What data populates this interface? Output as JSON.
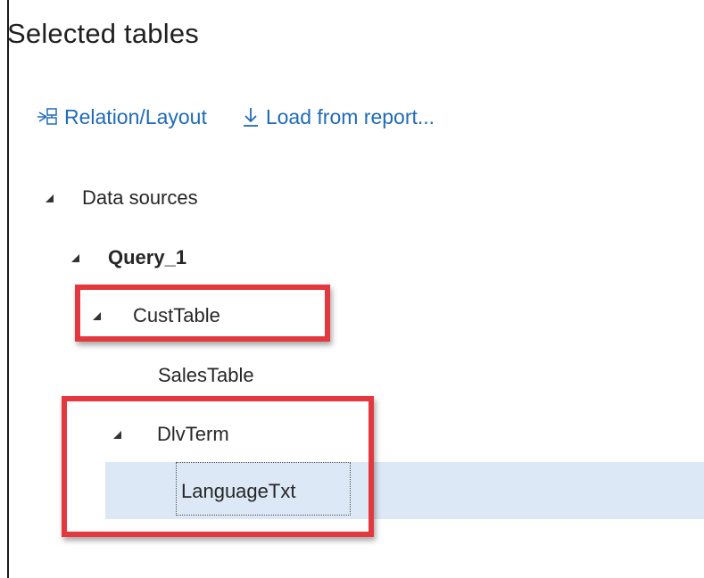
{
  "panel": {
    "title": "Selected tables"
  },
  "toolbar": {
    "relation_layout_label": "Relation/Layout",
    "load_from_report_label": "Load from report..."
  },
  "tree": {
    "data_sources_label": "Data sources",
    "query_label": "Query_1",
    "cust_table_label": "CustTable",
    "sales_table_label": "SalesTable",
    "dlv_term_label": "DlvTerm",
    "language_txt_label": "LanguageTxt"
  },
  "icons": {
    "expander": "expanded-triangle-icon",
    "relation_layout": "relation-layout-icon",
    "load": "download-arrow-icon"
  },
  "colors": {
    "link": "#1f6bb8",
    "selection": "#dce8f5",
    "annotation": "#e4383f"
  }
}
